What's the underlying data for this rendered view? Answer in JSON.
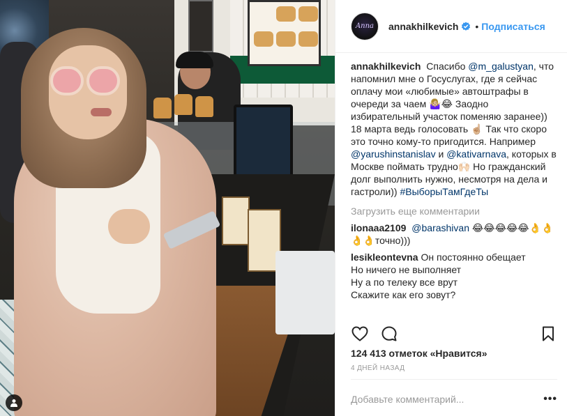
{
  "post": {
    "photo_label": "post photo",
    "tagged_icon": "person-tag-icon"
  },
  "header": {
    "username": "annakhilkevich",
    "dot": "•",
    "follow_label": "Подписаться",
    "verified_icon": "verified-badge-icon"
  },
  "caption": {
    "username": "annakhilkevich",
    "line1": "Спасибо",
    "mention1": "@m_galustyan",
    "line1b": ", что напомнил мне о Госуслугах, где я сейчас оплачу мои «любимые» автоштрафы в очереди за чаем 🤷🏼‍♀️😂 Заодно избирательный участок поменяю заранее)) 18 марта ведь голосовать ☝🏼 Так что скоро это точно кому-то пригодится. Например",
    "mention2": "@yarushinstanislav",
    "line2": "и",
    "mention3": "@kativarnava",
    "line3": ", которых в Москве поймать трудно🙌🏻 Но гражданский долг выполнить нужно, несмотря на дела и гастроли))",
    "hashtag": "#ВыборыТамГдеТы"
  },
  "load_more_label": "Загрузить еще комментарии",
  "comments": [
    {
      "username": "ilonaaa2109",
      "mention": "@barashivan",
      "text": "😂😂😂😂😂👌👌👌👌точно)))"
    },
    {
      "username": "lesikleontevna",
      "lines": [
        "Он постоянно обещает",
        "Но ничего не выполняет",
        "Ну а по телеку все врут",
        "Скажите как его зовут?"
      ]
    }
  ],
  "actions": {
    "like_icon": "heart-icon",
    "comment_icon": "comment-bubble-icon",
    "save_icon": "bookmark-icon"
  },
  "likes_text": "124 413 отметок «Нравится»",
  "time_text": "4 ДНЕЙ НАЗАД",
  "add_comment": {
    "placeholder": "Добавьте комментарий...",
    "more_label": "•••"
  },
  "colors": {
    "link_blue": "#3897f0",
    "mention_blue": "#003569",
    "muted_gray": "#999999",
    "text": "#262626"
  }
}
